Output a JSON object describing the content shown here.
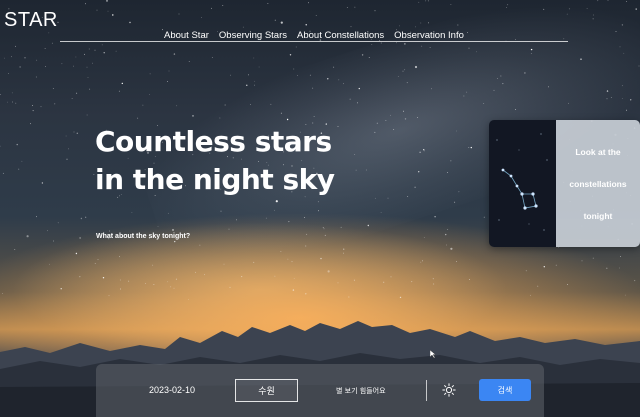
{
  "app": {
    "logo": "STAR"
  },
  "nav": {
    "items": [
      "About Star",
      "Observing Stars",
      "About Constellations",
      "Observation Info"
    ]
  },
  "hero": {
    "title_line1": "Countless stars",
    "title_line2": "in the night sky",
    "subtitle": "What about the sky tonight?"
  },
  "promo_card": {
    "lines": [
      "Look at the",
      "constellations",
      "tonight"
    ]
  },
  "search": {
    "date_value": "2023-02-10",
    "location_value": "수원",
    "status_text": "별 보기 힘들어요",
    "weather_icon": "sun-icon",
    "search_label": "검색",
    "button_color": "#3b86f3"
  },
  "colors": {
    "accent": "#3b86f3",
    "text": "#ffffff"
  }
}
